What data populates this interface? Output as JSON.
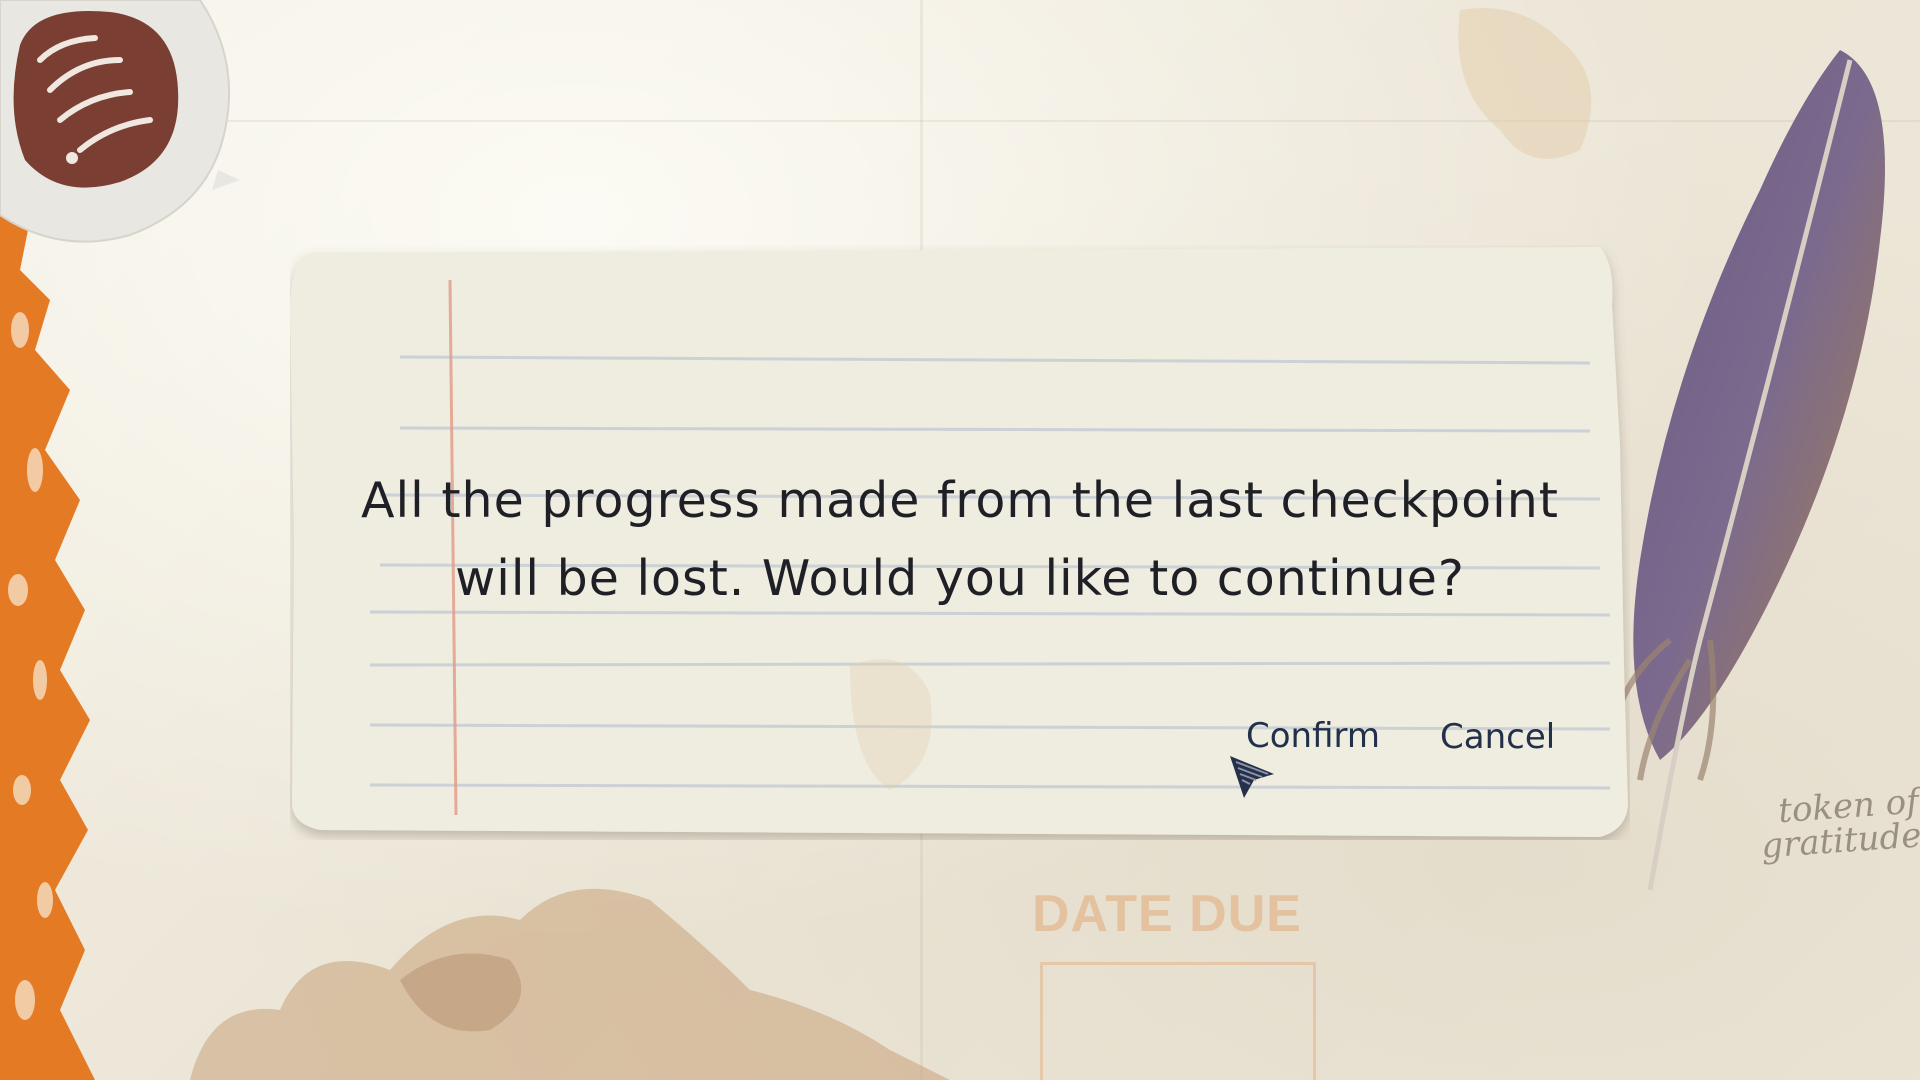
{
  "dialog": {
    "message_line1": "All the progress made from the last checkpoint",
    "message_line2": "will be lost. Would you like to continue?",
    "confirm_label": "Confirm",
    "cancel_label": "Cancel"
  },
  "background": {
    "stamp_text": "DATE DUE",
    "note_text": "token of\ngratitude"
  },
  "icons": {
    "avatar": "character-head-icon",
    "feather": "feather-icon",
    "cursor": "pointer-cursor-icon"
  },
  "colors": {
    "text": "#1f1f26",
    "button_text": "#22304a",
    "paper": "#f0ece0",
    "accent_orange": "#e57a24",
    "feather_purple": "#6b5a80"
  }
}
